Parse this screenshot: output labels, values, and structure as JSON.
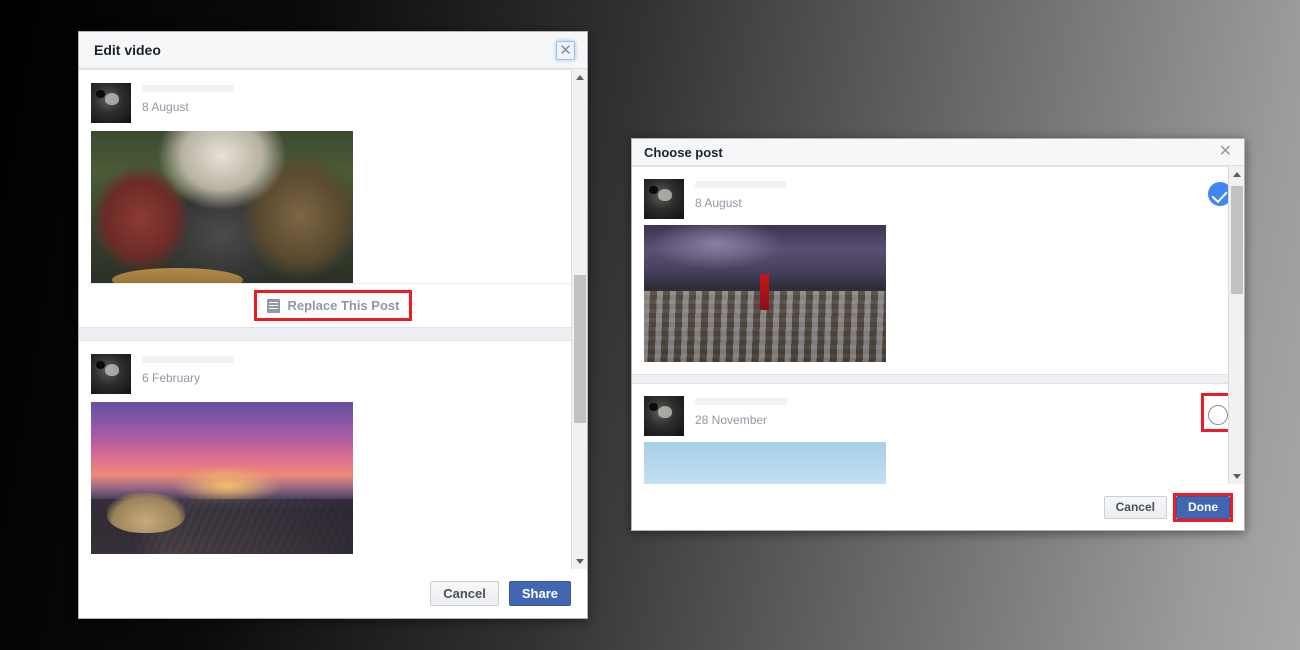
{
  "edit_dialog": {
    "title": "Edit video",
    "close_icon": "close-icon",
    "posts": [
      {
        "date": "8 August",
        "photo": "medieval-warriors-helmet-photo",
        "action_label": "Replace This Post",
        "action_icon": "document-list-icon"
      },
      {
        "date": "6 February",
        "photo": "sunset-city-square-photo"
      }
    ],
    "footer": {
      "cancel_label": "Cancel",
      "share_label": "Share"
    }
  },
  "choose_dialog": {
    "title": "Choose post",
    "close_icon": "close-icon",
    "posts": [
      {
        "date": "8 August",
        "photo": "army-stormy-sky-photo",
        "selected": true,
        "selector_icon": "check-circle-icon"
      },
      {
        "date": "28 November",
        "photo": "tower-above-clouds-photo",
        "selected": false,
        "selector_icon": "radio-empty-icon"
      }
    ],
    "footer": {
      "cancel_label": "Cancel",
      "done_label": "Done"
    }
  },
  "colors": {
    "primary_button": "#4267b2",
    "done_button": "#4267b2",
    "selected_check": "#4285f4",
    "highlight_annotation": "#ee1b24",
    "header_background": "#f6f7f8",
    "muted_text": "#9197a3"
  }
}
